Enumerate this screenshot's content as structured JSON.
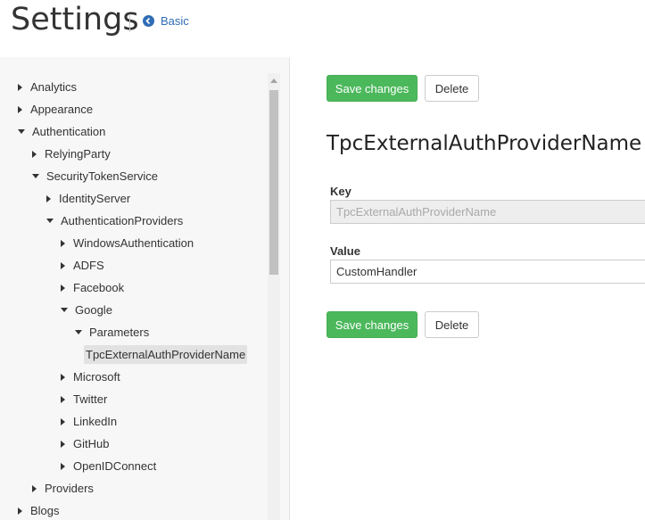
{
  "header": {
    "title": "Settings",
    "back_label": "Basic"
  },
  "tree": [
    {
      "label": "Analytics",
      "level": 0,
      "state": "collapsed"
    },
    {
      "label": "Appearance",
      "level": 0,
      "state": "collapsed"
    },
    {
      "label": "Authentication",
      "level": 0,
      "state": "expanded"
    },
    {
      "label": "RelyingParty",
      "level": 1,
      "state": "collapsed"
    },
    {
      "label": "SecurityTokenService",
      "level": 1,
      "state": "expanded"
    },
    {
      "label": "IdentityServer",
      "level": 2,
      "state": "collapsed"
    },
    {
      "label": "AuthenticationProviders",
      "level": 2,
      "state": "expanded"
    },
    {
      "label": "WindowsAuthentication",
      "level": 3,
      "state": "collapsed"
    },
    {
      "label": "ADFS",
      "level": 3,
      "state": "collapsed"
    },
    {
      "label": "Facebook",
      "level": 3,
      "state": "collapsed"
    },
    {
      "label": "Google",
      "level": 3,
      "state": "expanded"
    },
    {
      "label": "Parameters",
      "level": 4,
      "state": "expanded"
    },
    {
      "label": "TpcExternalAuthProviderName",
      "level": 5,
      "state": "leaf",
      "selected": true
    },
    {
      "label": "Microsoft",
      "level": 3,
      "state": "collapsed"
    },
    {
      "label": "Twitter",
      "level": 3,
      "state": "collapsed"
    },
    {
      "label": "LinkedIn",
      "level": 3,
      "state": "collapsed"
    },
    {
      "label": "GitHub",
      "level": 3,
      "state": "collapsed"
    },
    {
      "label": "OpenIDConnect",
      "level": 3,
      "state": "collapsed"
    },
    {
      "label": "Providers",
      "level": 1,
      "state": "collapsed"
    },
    {
      "label": "Blogs",
      "level": 0,
      "state": "collapsed"
    }
  ],
  "main": {
    "save_label": "Save changes",
    "delete_label": "Delete",
    "setting_title": "TpcExternalAuthProviderName",
    "key_label": "Key",
    "key_value": "TpcExternalAuthProviderName",
    "value_label": "Value",
    "value_value": "CustomHandler"
  },
  "colors": {
    "primary": "#4cb85c",
    "link": "#2f6db5",
    "selected_bg": "#e2e2e2"
  }
}
